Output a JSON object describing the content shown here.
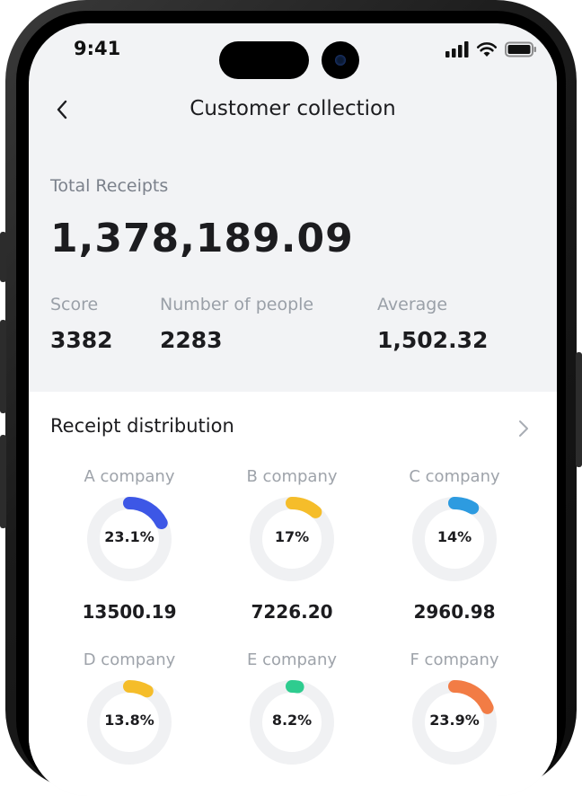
{
  "status": {
    "time": "9:41"
  },
  "header": {
    "title": "Customer collection"
  },
  "summary": {
    "label": "Total Receipts",
    "value": "1,378,189.09",
    "stats": [
      {
        "label": "Score",
        "value": "3382"
      },
      {
        "label": "Number of people",
        "value": "2283"
      },
      {
        "label": "Average",
        "value": "1,502.32"
      }
    ]
  },
  "distribution": {
    "title": "Receipt distribution",
    "items": [
      {
        "name": "A company",
        "percent_label": "23.1%",
        "percent": 23.1,
        "amount": "13500.19",
        "color": "#3d57e6"
      },
      {
        "name": "B company",
        "percent_label": "17%",
        "percent": 17,
        "amount": "7226.20",
        "color": "#f5bd2a"
      },
      {
        "name": "C company",
        "percent_label": "14%",
        "percent": 14,
        "amount": "2960.98",
        "color": "#2d9be0"
      },
      {
        "name": "D company",
        "percent_label": "13.8%",
        "percent": 13.8,
        "amount": "",
        "color": "#f5bd2a"
      },
      {
        "name": "E company",
        "percent_label": "8.2%",
        "percent": 8.2,
        "amount": "",
        "color": "#2ecc8f"
      },
      {
        "name": "F company",
        "percent_label": "23.9%",
        "percent": 23.9,
        "amount": "",
        "color": "#f27c45"
      }
    ]
  }
}
